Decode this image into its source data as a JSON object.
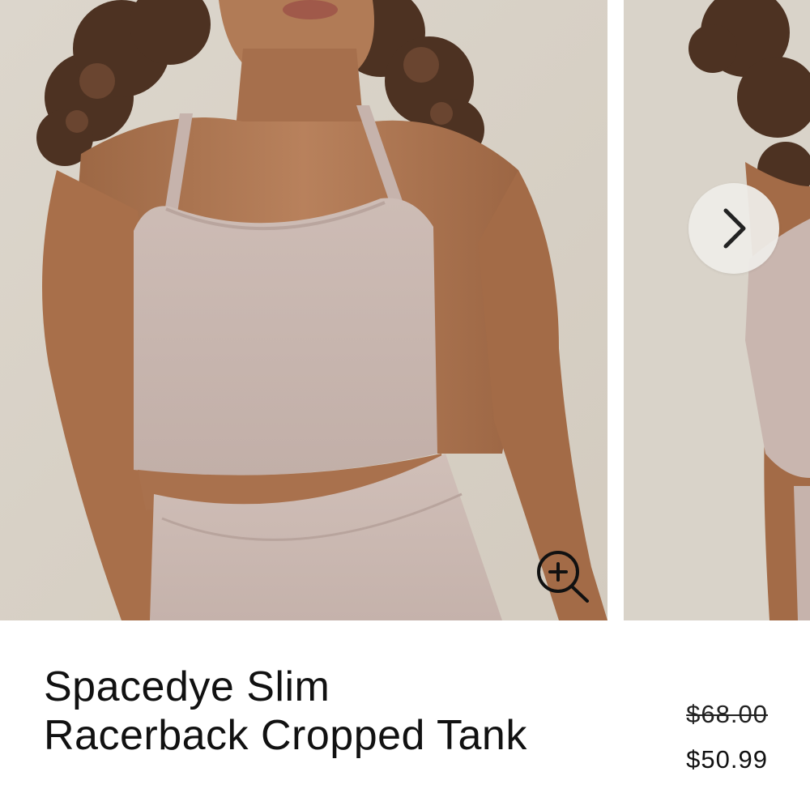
{
  "product": {
    "title": "Spacedye Slim Racerback Cropped Tank",
    "original_price": "$68.00",
    "sale_price": "$50.99"
  },
  "gallery": {
    "icons": [
      "zoom-in-icon",
      "chevron-right-icon"
    ]
  },
  "colors": {
    "backdrop": "#d8d1c7",
    "skin": "#b07a55",
    "garment": "#c9b5ae",
    "hair": "#4a3020"
  }
}
